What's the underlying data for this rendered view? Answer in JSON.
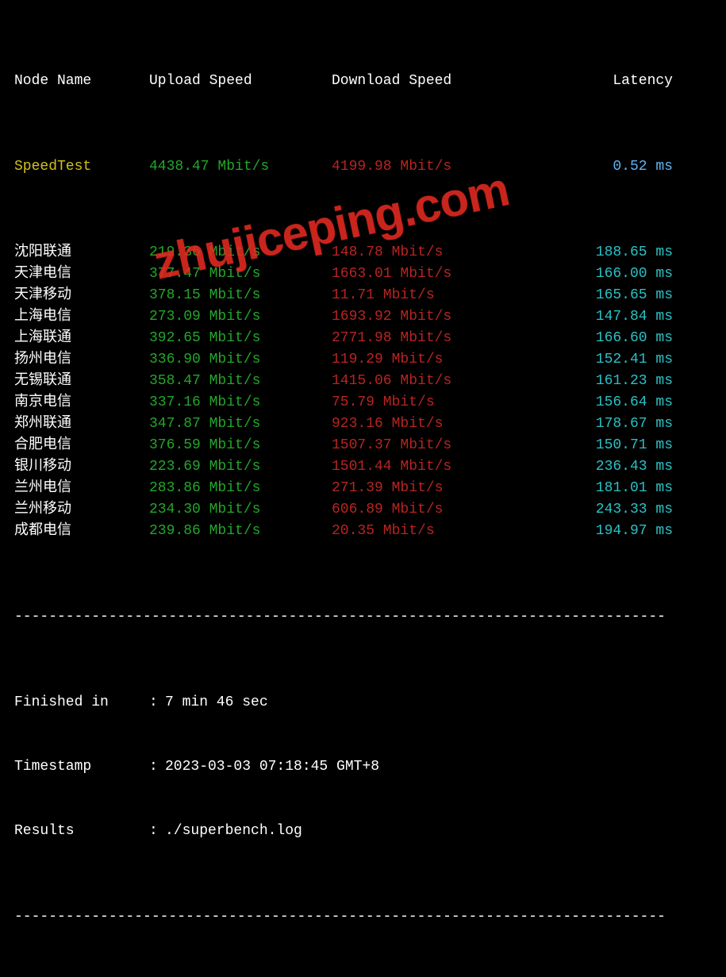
{
  "headers": {
    "node": "Node Name",
    "upload": "Upload Speed",
    "download": "Download Speed",
    "latency": "Latency"
  },
  "speedtest_row": {
    "node": "SpeedTest",
    "upload": "4438.47 Mbit/s",
    "download": "4199.98 Mbit/s",
    "latency": "0.52 ms"
  },
  "rows": [
    {
      "node": "沈阳联通",
      "upload": "219.36 Mbit/s",
      "download": "148.78 Mbit/s",
      "latency": "188.65 ms"
    },
    {
      "node": "天津电信",
      "upload": "377.47 Mbit/s",
      "download": "1663.01 Mbit/s",
      "latency": "166.00 ms"
    },
    {
      "node": "天津移动",
      "upload": "378.15 Mbit/s",
      "download": "11.71 Mbit/s",
      "latency": "165.65 ms"
    },
    {
      "node": "上海电信",
      "upload": "273.09 Mbit/s",
      "download": "1693.92 Mbit/s",
      "latency": "147.84 ms"
    },
    {
      "node": "上海联通",
      "upload": "392.65 Mbit/s",
      "download": "2771.98 Mbit/s",
      "latency": "166.60 ms"
    },
    {
      "node": "扬州电信",
      "upload": "336.90 Mbit/s",
      "download": "119.29 Mbit/s",
      "latency": "152.41 ms"
    },
    {
      "node": "无锡联通",
      "upload": "358.47 Mbit/s",
      "download": "1415.06 Mbit/s",
      "latency": "161.23 ms"
    },
    {
      "node": "南京电信",
      "upload": "337.16 Mbit/s",
      "download": "75.79 Mbit/s",
      "latency": "156.64 ms"
    },
    {
      "node": "郑州联通",
      "upload": "347.87 Mbit/s",
      "download": "923.16 Mbit/s",
      "latency": "178.67 ms"
    },
    {
      "node": "合肥电信",
      "upload": "376.59 Mbit/s",
      "download": "1507.37 Mbit/s",
      "latency": "150.71 ms"
    },
    {
      "node": "银川移动",
      "upload": "223.69 Mbit/s",
      "download": "1501.44 Mbit/s",
      "latency": "236.43 ms"
    },
    {
      "node": "兰州电信",
      "upload": "283.86 Mbit/s",
      "download": "271.39 Mbit/s",
      "latency": "181.01 ms"
    },
    {
      "node": "兰州移动",
      "upload": "234.30 Mbit/s",
      "download": "606.89 Mbit/s",
      "latency": "243.33 ms"
    },
    {
      "node": "成都电信",
      "upload": "239.86 Mbit/s",
      "download": "20.35 Mbit/s",
      "latency": "194.97 ms"
    }
  ],
  "footer": {
    "finished_label": "Finished in",
    "finished_value": "7 min 46 sec",
    "timestamp_label": "Timestamp",
    "timestamp_value": "2023-03-03 07:18:45 GMT+8",
    "results_label": "Results",
    "results_value": "./superbench.log"
  },
  "divider": "----------------------------------------------------------------------------",
  "watermark": "zhujiceping.com"
}
